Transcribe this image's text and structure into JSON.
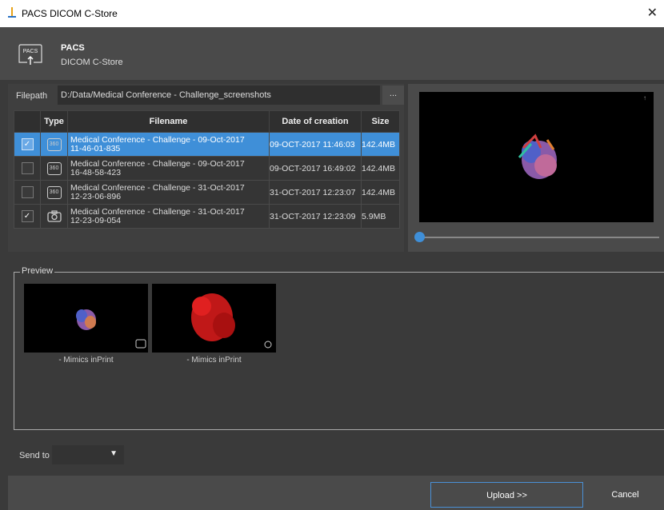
{
  "window": {
    "title": "PACS DICOM C-Store",
    "close_glyph": "✕"
  },
  "header": {
    "logo_text": "PACS",
    "title": "PACS",
    "subtitle": "DICOM C-Store"
  },
  "filepath": {
    "label": "Filepath",
    "value": "D:/Data/Medical Conference - Challenge_screenshots",
    "browse_label": "..."
  },
  "table": {
    "headers": {
      "type": "Type",
      "filename": "Filename",
      "date": "Date of creation",
      "size": "Size"
    },
    "rows": [
      {
        "checked": true,
        "type_icon": "360-icon",
        "filename_l1": "Medical Conference - Challenge - 09-Oct-2017",
        "filename_l2": "11-46-01-835",
        "date": "09-OCT-2017 11:46:03",
        "size": "142.4MB"
      },
      {
        "checked": false,
        "type_icon": "360-icon",
        "filename_l1": "Medical Conference - Challenge - 09-Oct-2017",
        "filename_l2": "16-48-58-423",
        "date": "09-OCT-2017 16:49:02",
        "size": "142.4MB"
      },
      {
        "checked": false,
        "type_icon": "360-icon",
        "filename_l1": "Medical Conference - Challenge - 31-Oct-2017",
        "filename_l2": "12-23-06-896",
        "date": "31-OCT-2017 12:23:07",
        "size": "142.4MB"
      },
      {
        "checked": true,
        "type_icon": "camera-icon",
        "filename_l1": "Medical Conference - Challenge - 31-Oct-2017",
        "filename_l2": "12-23-09-054",
        "date": "31-OCT-2017 12:23:09",
        "size": "5.9MB"
      }
    ]
  },
  "preview": {
    "title": "Preview",
    "thumbs": [
      {
        "caption": "- Mimics inPrint",
        "icon": "360-icon"
      },
      {
        "caption": "- Mimics inPrint",
        "icon": "camera-icon"
      }
    ]
  },
  "send_to": {
    "label": "Send to",
    "value": ""
  },
  "footer": {
    "upload_label": "Upload >>",
    "cancel_label": "Cancel"
  },
  "colors": {
    "accent": "#3f8fd8",
    "background": "#3a3a3a"
  }
}
